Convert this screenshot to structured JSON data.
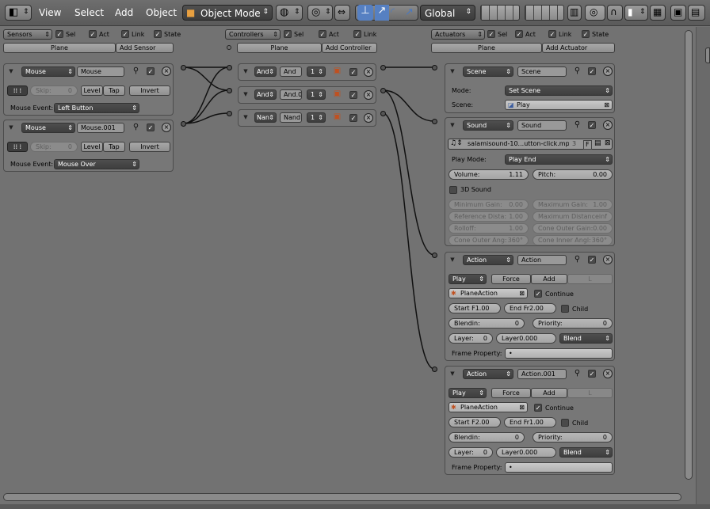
{
  "topbar": {
    "menus": [
      "View",
      "Select",
      "Add",
      "Object"
    ],
    "mode": "Object Mode",
    "orientation": "Global"
  },
  "columns": {
    "sensors": {
      "title": "Sensors",
      "sel": "Sel",
      "act": "Act",
      "link": "Link",
      "state": "State",
      "object": "Plane",
      "add": "Add Sensor"
    },
    "controllers": {
      "title": "Controllers",
      "sel": "Sel",
      "act": "Act",
      "link": "Link",
      "object": "Plane",
      "add": "Add Controller"
    },
    "actuators": {
      "title": "Actuators",
      "sel": "Sel",
      "act": "Act",
      "link": "Link",
      "state": "State",
      "object": "Plane",
      "add": "Add Actuator"
    }
  },
  "sensors": [
    {
      "type": "Mouse",
      "name": "Mouse",
      "skip_label": "Skip:",
      "skip": "0",
      "level": "Level",
      "tap": "Tap",
      "invert": "Invert",
      "event_label": "Mouse Event:",
      "event": "Left Button"
    },
    {
      "type": "Mouse",
      "name": "Mouse.001",
      "skip_label": "Skip:",
      "skip": "0",
      "level": "Level",
      "tap": "Tap",
      "invert": "Invert",
      "event_label": "Mouse Event:",
      "event": "Mouse Over"
    }
  ],
  "controllers": [
    {
      "type": "And",
      "name": "And",
      "state": "1"
    },
    {
      "type": "And",
      "name": "And.0",
      "state": "1"
    },
    {
      "type": "Nan",
      "name": "Nand",
      "state": "1"
    }
  ],
  "scene": {
    "type": "Scene",
    "name": "Scene",
    "mode_label": "Mode:",
    "mode": "Set Scene",
    "scene_label": "Scene:",
    "scene": "Play"
  },
  "sound": {
    "type": "Sound",
    "name": "Sound",
    "file": "salamisound-10...utton-click.mp3",
    "users": "3",
    "f": "F",
    "playmode_label": "Play Mode:",
    "playmode": "Play End",
    "volume_label": "Volume:",
    "volume": "1.11",
    "pitch_label": "Pitch:",
    "pitch": "0.00",
    "sound3d": "3D Sound",
    "disabled": [
      [
        "Minimum Gain:",
        "0.00"
      ],
      [
        "Maximum Gain:",
        "1.00"
      ],
      [
        "Reference Dista:",
        "1.00"
      ],
      [
        "Maximum Distance",
        "inf"
      ],
      [
        "Rolloff:",
        "1.00"
      ],
      [
        "Cone Outer Gain:",
        "0.00"
      ],
      [
        "Cone Outer Ang:",
        "360°"
      ],
      [
        "Cone Inner Angl:",
        "360°"
      ]
    ]
  },
  "actions": [
    {
      "type": "Action",
      "name": "Action",
      "play": "Play",
      "force": "Force",
      "add": "Add",
      "l": "L",
      "action": "PlaneAction",
      "continue": "Continue",
      "start": "Start F1.00",
      "end": "End Fr2.00",
      "child": "Child",
      "blendin_label": "Blendin:",
      "blendin": "0",
      "priority_label": "Priority:",
      "priority": "0",
      "layer_label": "Layer:",
      "layer": "0",
      "layerw": "Layer0.000",
      "blend": "Blend",
      "frameprop": "Frame Property:",
      "frameprop_val": "•"
    },
    {
      "type": "Action",
      "name": "Action.001",
      "play": "Play",
      "force": "Force",
      "add": "Add",
      "l": "L",
      "action": "PlaneAction",
      "continue": "Continue",
      "start": "Start F2.00",
      "end": "End Fr1.00",
      "child": "Child",
      "blendin_label": "Blendin:",
      "blendin": "0",
      "priority_label": "Priority:",
      "priority": "0",
      "layer_label": "Layer:",
      "layer": "0",
      "layerw": "Layer0.000",
      "blend": "Blend",
      "frameprop": "Frame Property:",
      "frameprop_val": "•"
    }
  ]
}
